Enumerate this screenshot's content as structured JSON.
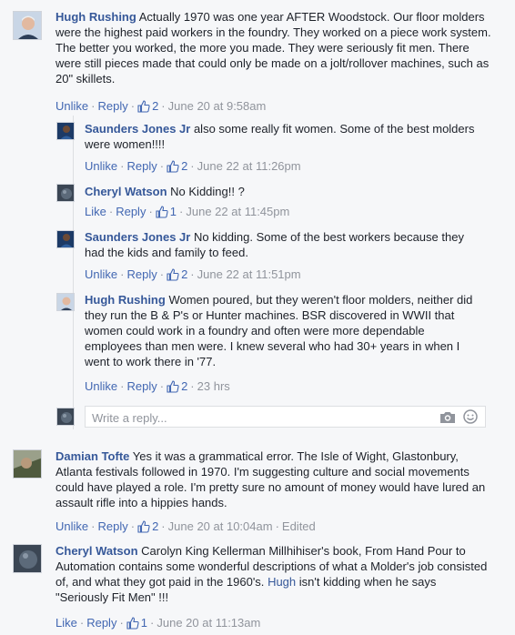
{
  "comments": [
    {
      "author": "Hugh Rushing",
      "text": "Actually 1970 was one year AFTER Woodstock. Our floor molders were the highest paid workers in the foundry. They worked on a piece work system. The better you worked, the more you made. They were seriously fit men. There were still pieces made that could only be made on a jolt/rollover machines, such as 20\" skillets.",
      "unlike": "Unlike",
      "reply": "Reply",
      "likes": "2",
      "time": "June 20 at 9:58am",
      "replies": [
        {
          "author": "Saunders Jones Jr",
          "text": "also some really fit women. Some of the best molders were women!!!!",
          "unlike": "Unlike",
          "reply": "Reply",
          "likes": "2",
          "time": "June 22 at 11:26pm"
        },
        {
          "author": "Cheryl Watson",
          "text": "No Kidding!! ?",
          "like": "Like",
          "reply": "Reply",
          "likes": "1",
          "time": "June 22 at 11:45pm"
        },
        {
          "author": "Saunders Jones Jr",
          "text": "No kidding. Some of the best workers because they had the kids and family to feed.",
          "unlike": "Unlike",
          "reply": "Reply",
          "likes": "2",
          "time": "June 22 at 11:51pm"
        },
        {
          "author": "Hugh Rushing",
          "text": "Women poured, but they weren't floor molders, neither did they run the B & P's or Hunter machines. BSR discovered in WWII that women could work in a foundry and often were more dependable employees than men were. I knew several who had 30+ years in when I went to work there in '77.",
          "unlike": "Unlike",
          "reply": "Reply",
          "likes": "2",
          "time": "23 hrs"
        }
      ],
      "reply_box": {
        "placeholder": "Write a reply..."
      }
    },
    {
      "author": "Damian Tofte",
      "text": "Yes it was a grammatical error. The Isle of Wight, Glastonbury, Atlanta festivals followed in 1970. I'm suggesting culture and social movements could have played a role. I'm pretty sure no amount of money would have lured an assault rifle into a hippies hands.",
      "unlike": "Unlike",
      "reply": "Reply",
      "likes": "2",
      "time": "June 20 at 10:04am",
      "edited": "Edited"
    },
    {
      "author": "Cheryl Watson",
      "text_before": "Carolyn King Kellerman Millhihiser's book, From Hand Pour to Automation contains some wonderful descriptions of what a Molder's job consisted of, and what they got paid in the 1960's.",
      "mention": "Hugh",
      "text_after": "isn't kidding when he says \"Seriously Fit Men\" !!!",
      "like": "Like",
      "reply": "Reply",
      "likes": "1",
      "time": "June 20 at 11:13am"
    }
  ],
  "separator": "·",
  "icons": {
    "like": "thumbs-up-icon",
    "camera": "camera-icon",
    "emoji": "emoji-icon"
  },
  "colors": {
    "name": "#365899",
    "action_link": "#4267b2",
    "meta": "#90949c",
    "text": "#1d2129",
    "background": "#f6f7f9"
  }
}
